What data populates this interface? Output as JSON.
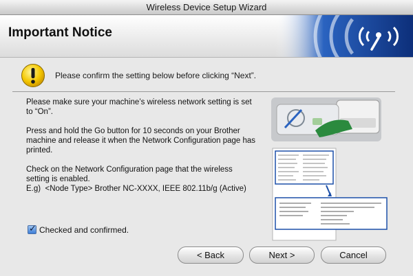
{
  "window": {
    "title": "Wireless Device Setup Wizard"
  },
  "header": {
    "title": "Important Notice"
  },
  "notice": {
    "text": "Please confirm the setting below before clicking “Next”."
  },
  "instructions": [
    "Please make sure your machine’s wireless network setting is set to “On”.",
    "Press and hold the Go button for 10 seconds on your Brother machine and release it when the Network Configuration page has printed.",
    "Check on the Network Configuration page that the wireless setting is enabled.",
    "E.g)  <Node Type> Brother NC-XXXX, IEEE 802.11b/g (Active)"
  ],
  "checkbox": {
    "label": "Checked and confirmed.",
    "checked": true
  },
  "buttons": {
    "back": "< Back",
    "next": "Next >",
    "cancel": "Cancel"
  },
  "colors": {
    "accent_blue": "#1b4fa8",
    "warning_yellow": "#f5c800"
  },
  "icons": {
    "warning": "warning-icon",
    "wireless_logo": "wireless-signal-icon"
  }
}
